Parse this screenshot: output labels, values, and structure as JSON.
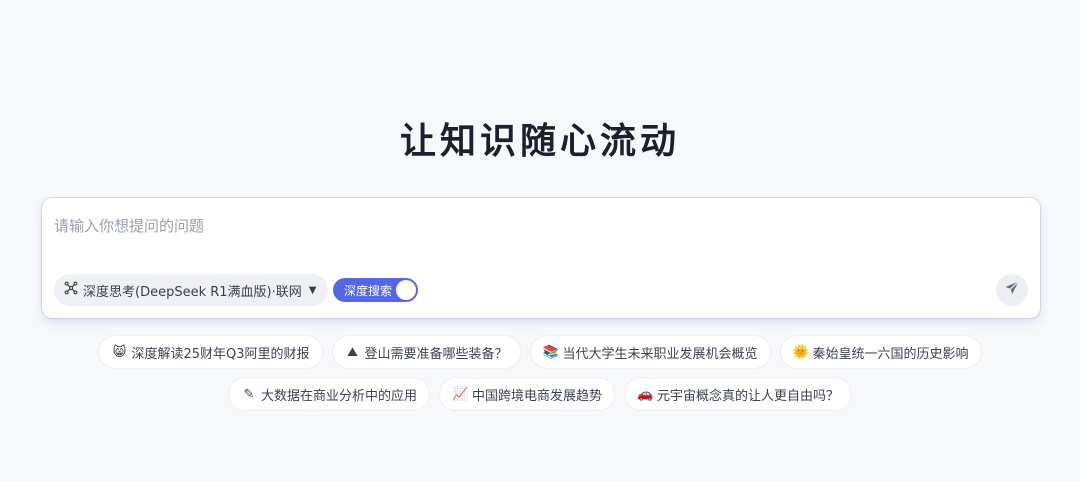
{
  "hero": {
    "title": "让知识随心流动"
  },
  "ask": {
    "placeholder": "请输入你想提问的问题",
    "mode_label": "深度思考(DeepSeek R1满血版)·联网",
    "toggle_label": "深度搜索",
    "toggle_on": true
  },
  "suggestions": {
    "row1": [
      {
        "emoji": "😸",
        "text": "深度解读25财年Q3阿里的财报"
      },
      {
        "emoji": "⛰",
        "text": "登山需要准备哪些装备？"
      },
      {
        "emoji": "📚",
        "text": "当代大学生未来职业发展机会概览"
      },
      {
        "emoji": "🌞",
        "text": "秦始皇统一六国的历史影响"
      }
    ],
    "row2": [
      {
        "emoji": "✎",
        "text": "大数据在商业分析中的应用"
      },
      {
        "emoji": "📈",
        "text": "中国跨境电商发展趋势"
      },
      {
        "emoji": "🚗",
        "text": "元宇宙概念真的让人更自由吗？"
      }
    ]
  },
  "colors": {
    "accent": "#5567e8",
    "background": "#f7f8fa",
    "title": "#1b1f2e"
  }
}
